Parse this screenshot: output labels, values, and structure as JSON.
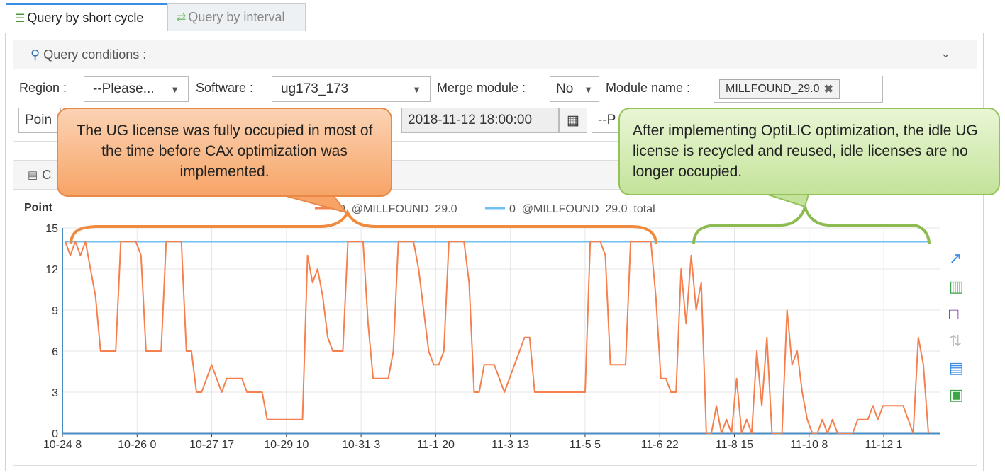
{
  "tabs": {
    "short": "Query by short cycle",
    "interval": "Query by interval"
  },
  "conditions": {
    "title": "Query conditions :",
    "region_label": "Region :",
    "region_value": "--Please...",
    "software_label": "Software :",
    "software_value": "ug173_173",
    "merge_label": "Merge module :",
    "merge_value": "No",
    "module_label": "Module name :",
    "module_tag": "MILLFOUND_29.0",
    "row2_first": "Poin",
    "end_time": "2018-11-12 18:00:00",
    "row2_select": "--P"
  },
  "chart_panel": {
    "title": "C"
  },
  "callouts": {
    "before": "The UG license was fully occupied in most of the time before CAx optimization was implemented.",
    "after": "After implementing OptiLIC optimization, the idle UG license is recycled and reused, idle licenses are no longer occupied."
  },
  "colors": {
    "usage": "#f5804d",
    "total": "#6fc1f1",
    "brace_before": "#f08a3e",
    "brace_after": "#8dbb52"
  },
  "tool_icons": [
    "line-chart-icon",
    "bar-chart-icon",
    "restore-icon",
    "data-zoom-icon",
    "data-view-icon",
    "save-image-icon"
  ],
  "chart_data": {
    "type": "line",
    "ylabel": "Point",
    "ylim": [
      0,
      15
    ],
    "yticks": [
      0,
      3,
      6,
      9,
      12,
      15
    ],
    "xticks": [
      "10-24 8",
      "10-26 0",
      "10-27 17",
      "10-29 10",
      "10-31 3",
      "11-1 20",
      "11-3 13",
      "11-5 5",
      "11-6 22",
      "11-8 15",
      "11-10 8",
      "11-12 1"
    ],
    "series": [
      {
        "name": "0_@MILLFOUND_29.0",
        "values": [
          14,
          13,
          14,
          13,
          14,
          12,
          10,
          6,
          6,
          6,
          6,
          14,
          14,
          14,
          14,
          13,
          6,
          6,
          6,
          6,
          14,
          14,
          14,
          14,
          6,
          6,
          3,
          3,
          4,
          5,
          4,
          3,
          4,
          4,
          4,
          4,
          3,
          3,
          3,
          3,
          1,
          1,
          1,
          1,
          1,
          1,
          1,
          1,
          13,
          11,
          12,
          10,
          7,
          6,
          6,
          6,
          14,
          14,
          14,
          14,
          8,
          4,
          4,
          4,
          4,
          6,
          14,
          14,
          14,
          14,
          12,
          9,
          6,
          5,
          5,
          6,
          14,
          14,
          14,
          14,
          11,
          3,
          3,
          5,
          5,
          5,
          4,
          3,
          4,
          5,
          6,
          7,
          7,
          3,
          3,
          3,
          3,
          3,
          3,
          3,
          3,
          3,
          3,
          3,
          14,
          14,
          14,
          13,
          5,
          5,
          5,
          5,
          14,
          14,
          14,
          14,
          14,
          10,
          4,
          4,
          3,
          3,
          12,
          8,
          13,
          9,
          11,
          0,
          0,
          2,
          0,
          1,
          0,
          4,
          0,
          1,
          0,
          6,
          2,
          7,
          0,
          0,
          0,
          9,
          5,
          6,
          3,
          1,
          0,
          0,
          1,
          0,
          1,
          0,
          0,
          0,
          0,
          1,
          1,
          1,
          2,
          1,
          2,
          2,
          2,
          2,
          2,
          1,
          0,
          7,
          5,
          0
        ]
      },
      {
        "name": "0_@MILLFOUND_29.0_total",
        "values": [
          14,
          14
        ]
      }
    ]
  }
}
